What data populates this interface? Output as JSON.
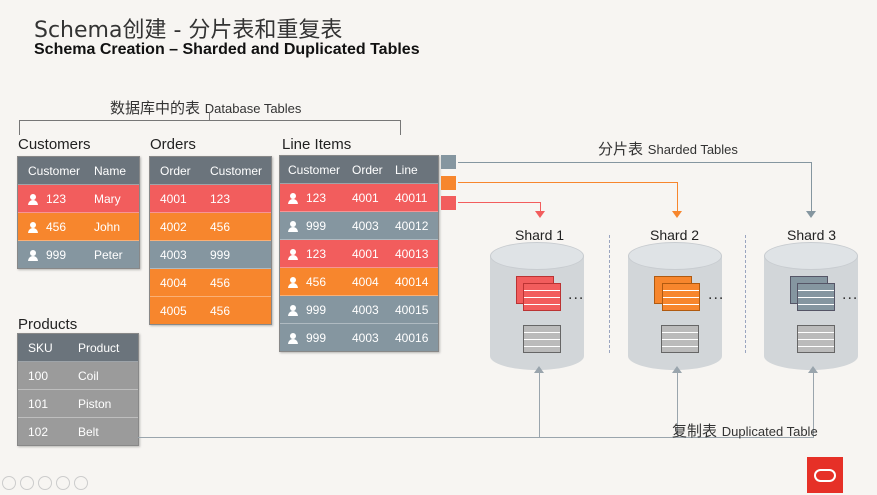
{
  "title_zh": "Schema创建 - 分片表和重复表",
  "title_en": "Schema Creation – Sharded and Duplicated Tables",
  "database_tables": {
    "zh": "数据库中的表",
    "en": "Database Tables"
  },
  "customers": {
    "label": "Customers",
    "headers": [
      "Customer",
      "Name"
    ],
    "rows": [
      [
        "123",
        "Mary"
      ],
      [
        "456",
        "John"
      ],
      [
        "999",
        "Peter"
      ]
    ]
  },
  "orders": {
    "label": "Orders",
    "headers": [
      "Order",
      "Customer"
    ],
    "rows": [
      [
        "4001",
        "123"
      ],
      [
        "4002",
        "456"
      ],
      [
        "4003",
        "999"
      ],
      [
        "4004",
        "456"
      ],
      [
        "4005",
        "456"
      ]
    ]
  },
  "line_items": {
    "label": "Line Items",
    "headers": [
      "Customer",
      "Order",
      "Line"
    ],
    "rows": [
      [
        "123",
        "4001",
        "40011"
      ],
      [
        "999",
        "4003",
        "40012"
      ],
      [
        "123",
        "4001",
        "40013"
      ],
      [
        "456",
        "4004",
        "40014"
      ],
      [
        "999",
        "4003",
        "40015"
      ],
      [
        "999",
        "4003",
        "40016"
      ]
    ]
  },
  "products": {
    "label": "Products",
    "headers": [
      "SKU",
      "Product"
    ],
    "rows": [
      [
        "100",
        "Coil"
      ],
      [
        "101",
        "Piston"
      ],
      [
        "102",
        "Belt"
      ]
    ]
  },
  "sharded_tables": {
    "zh": "分片表",
    "en": "Sharded Tables"
  },
  "duplicated_table": {
    "zh": "复制表",
    "en": "Duplicated Table"
  },
  "shards": [
    "Shard 1",
    "Shard 2",
    "Shard 3"
  ],
  "ellipsis": "...",
  "colors": {
    "red": "#f25d5d",
    "orange": "#f7862d",
    "gray": "#8596a0",
    "oracle": "#e63027"
  },
  "icons": [
    "person-icon",
    "oracle-logo-icon",
    "table-grid-icon"
  ]
}
